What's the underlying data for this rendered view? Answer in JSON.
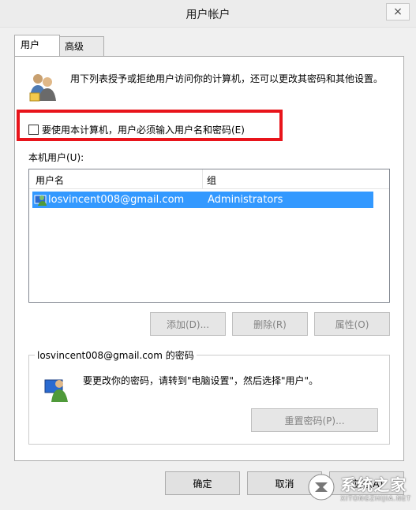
{
  "window": {
    "title": "用户帐户",
    "close_icon": "×"
  },
  "tabs": [
    {
      "label": "用户"
    },
    {
      "label": "高级"
    }
  ],
  "intro": {
    "text": "用下列表授予或拒绝用户访问你的计算机，还可以更改其密码和其他设置。"
  },
  "require_password": {
    "label": "要使用本计算机，用户必须输入用户名和密码(E)",
    "checked": false,
    "highlight_color": "#e8141b"
  },
  "local_users": {
    "label": "本机用户(U):",
    "columns": [
      "用户名",
      "组"
    ],
    "rows": [
      {
        "user": "losvincent008@gmail.com",
        "group": "Administrators",
        "selected": true
      }
    ],
    "selection_color": "#3399ff"
  },
  "list_buttons": {
    "add": "添加(D)...",
    "remove": "删除(R)",
    "properties": "属性(O)"
  },
  "password_group": {
    "title": "losvincent008@gmail.com 的密码",
    "text": "要更改你的密码，请转到\"电脑设置\"，然后选择\"用户\"。",
    "reset_button": "重置密码(P)..."
  },
  "dialog_buttons": {
    "ok": "确定",
    "cancel": "取消",
    "apply": "应用(A)"
  },
  "watermark": {
    "main": "系统之家",
    "sub": "XITONGZHIJIA.NET"
  }
}
